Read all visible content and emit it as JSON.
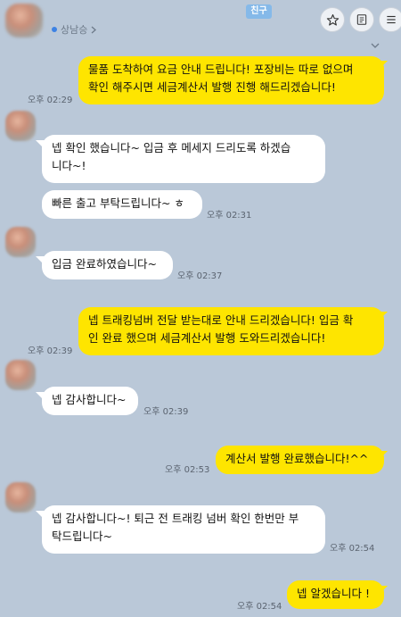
{
  "header": {
    "name": "상남승",
    "badge": "친구",
    "icons": {
      "star": "star-icon",
      "note": "document-icon",
      "menu": "menu-icon"
    }
  },
  "messages": [
    {
      "from": "me",
      "lines": [
        "물품 도착하여 요금 안내 드립니다! 포장비는 따로 없으며",
        "확인 해주시면 세금계산서 발행 진행 해드리겠습니다!"
      ],
      "time": "오후 02:29"
    },
    {
      "from": "friend",
      "lines": [
        "넵 확인 했습니다~ 입금 후 메세지 드리도록 하겠습",
        "니다~!"
      ],
      "time": ""
    },
    {
      "from": "friend",
      "lines": [
        "빠른 출고 부탁드립니다~ ㅎ"
      ],
      "time": "오후 02:31"
    },
    {
      "from": "friend",
      "lines": [
        "입금 완료하였습니다~"
      ],
      "time": "오후 02:37"
    },
    {
      "from": "me",
      "lines": [
        "넵 트래킹넘버 전달 받는대로 안내 드리겠습니다! 입금 확",
        "인 완료 했으며 세금계산서 발행 도와드리겠습니다!"
      ],
      "time": "오후 02:39"
    },
    {
      "from": "friend",
      "lines": [
        "넵 감사합니다~"
      ],
      "time": "오후 02:39"
    },
    {
      "from": "me",
      "lines": [
        "계산서 발행 완료했습니다!^^"
      ],
      "time": "오후 02:53"
    },
    {
      "from": "friend",
      "lines": [
        "넵 감사합니다~! 퇴근 전 트래킹 넘버 확인 한번만 부",
        "탁드립니다~"
      ],
      "time": "오후 02:54"
    },
    {
      "from": "me",
      "lines": [
        "넵 알겠습니다 !"
      ],
      "time": "오후 02:54"
    }
  ],
  "colors": {
    "background": "#bac8d8",
    "my_bubble": "#fee500",
    "their_bubble": "#ffffff",
    "badge": "#85b9e9"
  }
}
